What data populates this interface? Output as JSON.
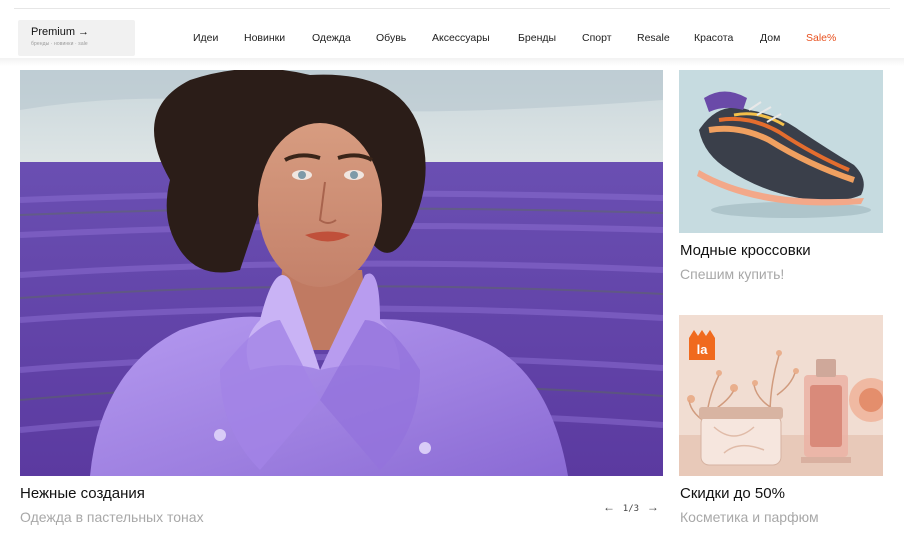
{
  "header": {
    "premium_label": "Premium →",
    "premium_sub": "бренды · новинки · sale",
    "nav": [
      {
        "label": "Идеи"
      },
      {
        "label": "Новинки"
      },
      {
        "label": "Одежда"
      },
      {
        "label": "Обувь"
      },
      {
        "label": "Аксессуары"
      },
      {
        "label": "Бренды"
      },
      {
        "label": "Спорт"
      },
      {
        "label": "Resale"
      },
      {
        "label": "Красота"
      },
      {
        "label": "Дом"
      },
      {
        "label": "Sale%"
      }
    ],
    "sale_color": "#e8501e"
  },
  "hero": {
    "title": "Нежные создания",
    "subtitle": "Одежда в пастельных тонах",
    "pager": {
      "prev": "←",
      "count": "1/3",
      "next": "→"
    }
  },
  "side_cards": [
    {
      "title": "Модные кроссовки",
      "subtitle": "Спешим купить!"
    },
    {
      "title": "Скидки до 50%",
      "subtitle": "Косметика и парфюм",
      "badge": "la"
    }
  ],
  "colors": {
    "accent": "#e8501e",
    "lavender": "#7d55c9",
    "coat": "#a98ae8"
  }
}
